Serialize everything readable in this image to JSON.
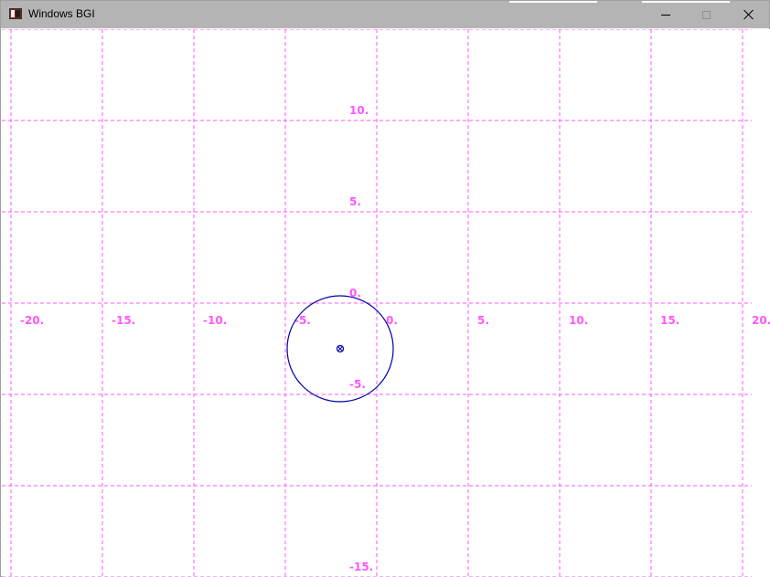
{
  "window": {
    "title": "Windows BGI",
    "controls": {
      "minimize_icon": "minimize-icon",
      "maximize_icon": "maximize-icon",
      "close_icon": "close-icon"
    }
  },
  "colors": {
    "grid": "#ff55ff",
    "labels": "#ff55ff",
    "circle": "#0000aa",
    "titlebar": "#b4b4b4"
  },
  "chart_data": {
    "type": "scatter",
    "x_ticks": [
      "-20.",
      "-15.",
      "-10.",
      "-5.",
      "0.",
      "5.",
      "10.",
      "15.",
      "20."
    ],
    "y_ticks": [
      "10.",
      "5.",
      "0.",
      "-5.",
      "-15."
    ],
    "xlim": [
      -20,
      20
    ],
    "ylim": [
      -15,
      15
    ],
    "grid": true,
    "circle": {
      "center": [
        -2,
        -2.5
      ],
      "radius": 2.9
    },
    "center_marker": [
      -2,
      -2.5
    ]
  }
}
